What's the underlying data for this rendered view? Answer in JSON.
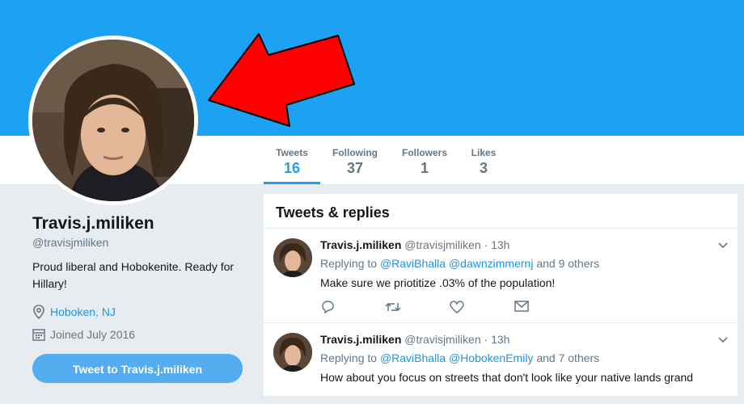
{
  "profile": {
    "name": "Travis.j.miliken",
    "handle": "@travisjmiliken",
    "bio": "Proud liberal and Hobokenite. Ready for Hillary!",
    "location": "Hoboken, NJ",
    "joined": "Joined July 2016",
    "tweet_to_button": "Tweet to Travis.j.miliken"
  },
  "stats": [
    {
      "label": "Tweets",
      "value": "16"
    },
    {
      "label": "Following",
      "value": "37"
    },
    {
      "label": "Followers",
      "value": "1"
    },
    {
      "label": "Likes",
      "value": "3"
    }
  ],
  "timeline": {
    "title": "Tweets & replies",
    "tweets": [
      {
        "name": "Travis.j.miliken",
        "handle": "@travisjmiliken",
        "time": "· 13h",
        "replying_prefix": "Replying to",
        "mention1": "@RaviBhalla",
        "mention2": "@dawnzimmernj",
        "others": "and 9 others",
        "text": "Make sure we priotitize .03% of the population!"
      },
      {
        "name": "Travis.j.miliken",
        "handle": "@travisjmiliken",
        "time": "· 13h",
        "replying_prefix": "Replying to",
        "mention1": "@RaviBhalla",
        "mention2": "@HobokenEmily",
        "others": "and 7 others",
        "text": "How about you focus on streets that don't look like your native lands grand"
      }
    ]
  },
  "colors": {
    "banner": "#1da1f2",
    "accent": "#1da1f2",
    "link": "#1b95e0",
    "button": "#55acee",
    "arrow": "#ff0000"
  },
  "icons": {
    "location": "location-pin-icon",
    "calendar": "calendar-icon",
    "reply": "reply-icon",
    "retweet": "retweet-icon",
    "like": "heart-icon",
    "message": "envelope-icon",
    "caret": "chevron-down-icon"
  }
}
